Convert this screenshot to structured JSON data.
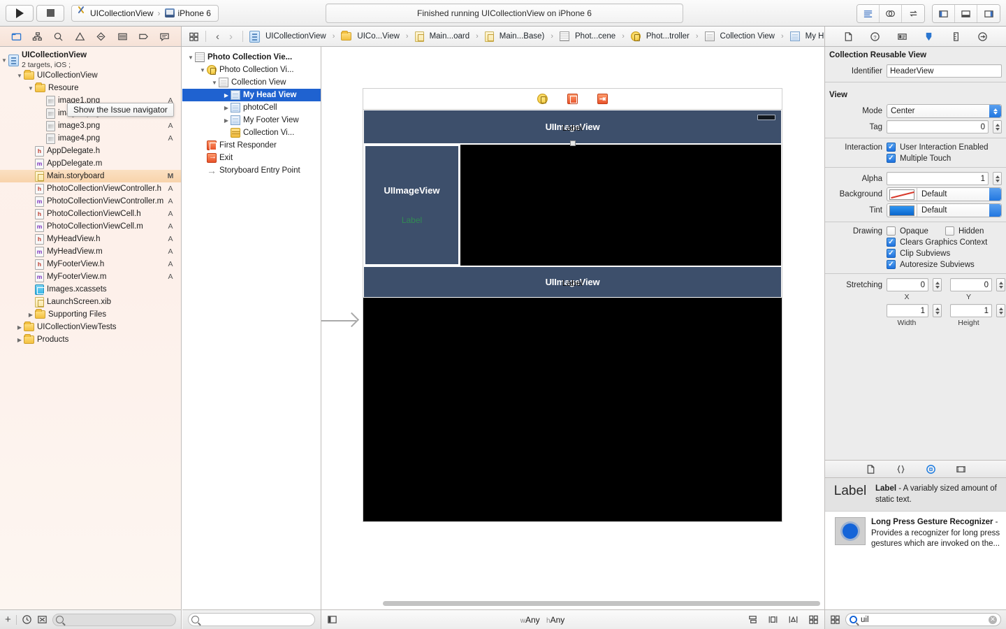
{
  "toolbar": {
    "run_button": "run-button",
    "stop_button": "stop-button",
    "scheme_name": "UICollectionView",
    "destination_name": "iPhone 6",
    "activity_status": "Finished running UICollectionView on iPhone 6",
    "editor_modes": [
      "standard-editor",
      "assistant-editor",
      "version-editor"
    ],
    "view_toggles": [
      "navigator-toggle",
      "debug-area-toggle",
      "utilities-toggle"
    ]
  },
  "navigator": {
    "tab_icons": [
      "project-navigator",
      "symbol-navigator",
      "find-navigator",
      "issue-navigator",
      "test-navigator",
      "debug-navigator",
      "breakpoint-navigator",
      "report-navigator"
    ],
    "tooltip": "Show the Issue navigator",
    "project": {
      "name": "UICollectionView",
      "subtitle": "2 targets, iOS ;"
    },
    "items": [
      {
        "label": "UICollectionView",
        "type": "folder",
        "indent": 1,
        "disclosure": "open",
        "status": ""
      },
      {
        "label": "Resoure",
        "type": "folder",
        "indent": 2,
        "disclosure": "open",
        "status": ""
      },
      {
        "label": "image1.png",
        "type": "png",
        "indent": 3,
        "disclosure": "",
        "status": "A"
      },
      {
        "label": "image2.png",
        "type": "png",
        "indent": 3,
        "disclosure": "",
        "status": "A"
      },
      {
        "label": "image3.png",
        "type": "png",
        "indent": 3,
        "disclosure": "",
        "status": "A"
      },
      {
        "label": "image4.png",
        "type": "png",
        "indent": 3,
        "disclosure": "",
        "status": "A"
      },
      {
        "label": "AppDelegate.h",
        "type": "h",
        "indent": 2,
        "disclosure": "",
        "status": ""
      },
      {
        "label": "AppDelegate.m",
        "type": "m",
        "indent": 2,
        "disclosure": "",
        "status": ""
      },
      {
        "label": "Main.storyboard",
        "type": "storyboard",
        "indent": 2,
        "disclosure": "",
        "status": "M",
        "selected": true
      },
      {
        "label": "PhotoCollectionViewController.h",
        "type": "h",
        "indent": 2,
        "disclosure": "",
        "status": "A"
      },
      {
        "label": "PhotoCollectionViewController.m",
        "type": "m",
        "indent": 2,
        "disclosure": "",
        "status": "A"
      },
      {
        "label": "PhotoCollectionViewCell.h",
        "type": "h",
        "indent": 2,
        "disclosure": "",
        "status": "A"
      },
      {
        "label": "PhotoCollectionViewCell.m",
        "type": "m",
        "indent": 2,
        "disclosure": "",
        "status": "A"
      },
      {
        "label": "MyHeadView.h",
        "type": "h",
        "indent": 2,
        "disclosure": "",
        "status": "A"
      },
      {
        "label": "MyHeadView.m",
        "type": "m",
        "indent": 2,
        "disclosure": "",
        "status": "A"
      },
      {
        "label": "MyFooterView.h",
        "type": "h",
        "indent": 2,
        "disclosure": "",
        "status": "A"
      },
      {
        "label": "MyFooterView.m",
        "type": "m",
        "indent": 2,
        "disclosure": "",
        "status": "A"
      },
      {
        "label": "Images.xcassets",
        "type": "xcassets",
        "indent": 2,
        "disclosure": "",
        "status": ""
      },
      {
        "label": "LaunchScreen.xib",
        "type": "storyboard",
        "indent": 2,
        "disclosure": "",
        "status": ""
      },
      {
        "label": "Supporting Files",
        "type": "folder",
        "indent": 2,
        "disclosure": "closed",
        "status": ""
      },
      {
        "label": "UICollectionViewTests",
        "type": "folder",
        "indent": 1,
        "disclosure": "closed",
        "status": ""
      },
      {
        "label": "Products",
        "type": "folder",
        "indent": 1,
        "disclosure": "closed",
        "status": ""
      }
    ],
    "bottom": {
      "add_button": "+",
      "filter_placeholder": ""
    }
  },
  "jumpbar": {
    "back": "‹",
    "forward": "›",
    "crumbs": [
      {
        "label": "UICollectionView",
        "icon": "project-icon"
      },
      {
        "label": "UICo...View",
        "icon": "folder-icon"
      },
      {
        "label": "Main...oard",
        "icon": "storyboard-icon"
      },
      {
        "label": "Main...Base)",
        "icon": "storyboard-icon"
      },
      {
        "label": "Phot...cene",
        "icon": "scene-icon"
      },
      {
        "label": "Phot...troller",
        "icon": "viewcontroller-icon"
      },
      {
        "label": "Collection View",
        "icon": "collectionview-icon"
      },
      {
        "label": "My Head View",
        "icon": "reusableview-icon"
      }
    ]
  },
  "outline": {
    "items": [
      {
        "label": "Photo Collection Vie...",
        "indent": 0,
        "disclosure": "open",
        "icon": "scene-icon",
        "bold": true
      },
      {
        "label": "Photo Collection Vi...",
        "indent": 1,
        "disclosure": "open",
        "icon": "viewcontroller-icon"
      },
      {
        "label": "Collection View",
        "indent": 2,
        "disclosure": "open",
        "icon": "collectionview-icon"
      },
      {
        "label": "My Head View",
        "indent": 3,
        "disclosure": "closed",
        "icon": "reusableview-icon",
        "selected": true
      },
      {
        "label": "photoCell",
        "indent": 3,
        "disclosure": "closed",
        "icon": "cell-icon"
      },
      {
        "label": "My Footer View",
        "indent": 3,
        "disclosure": "closed",
        "icon": "reusableview-icon"
      },
      {
        "label": "Collection Vi...",
        "indent": 3,
        "disclosure": "",
        "icon": "flowlayout-icon"
      },
      {
        "label": "First Responder",
        "indent": 1,
        "disclosure": "",
        "icon": "first-responder-icon"
      },
      {
        "label": "Exit",
        "indent": 1,
        "disclosure": "",
        "icon": "exit-icon"
      },
      {
        "label": "Storyboard Entry Point",
        "indent": 1,
        "disclosure": "",
        "icon": "entry-point-icon"
      }
    ]
  },
  "canvas": {
    "dock_icons": [
      "view-controller-icon",
      "first-responder-icon",
      "exit-icon"
    ],
    "header_view": {
      "image_label": "UIImageView",
      "text_label": "Label"
    },
    "photo_cell": {
      "image_label": "UIImageView",
      "text_label": "Label"
    },
    "footer_view": {
      "image_label": "UIImageView",
      "text_label": "Label"
    },
    "size_class": {
      "prefix_w": "w",
      "width": "Any",
      "prefix_h": "h",
      "height": "Any"
    },
    "bottom_icons": [
      "auto-layout-stack",
      "align-icon",
      "pin-icon",
      "resolve-issues-icon"
    ]
  },
  "inspector": {
    "tabs": [
      "file-inspector",
      "quick-help-inspector",
      "identity-inspector",
      "attributes-inspector",
      "size-inspector",
      "connections-inspector"
    ],
    "selected_tab_index": 3,
    "reusable_view": {
      "title": "Collection Reusable View",
      "identifier_label": "Identifier",
      "identifier_value": "HeaderView"
    },
    "view": {
      "title": "View",
      "mode_label": "Mode",
      "mode_value": "Center",
      "tag_label": "Tag",
      "tag_value": "0",
      "interaction_label": "Interaction",
      "user_interaction_enabled": {
        "label": "User Interaction Enabled",
        "checked": true
      },
      "multiple_touch": {
        "label": "Multiple Touch",
        "checked": true
      },
      "alpha_label": "Alpha",
      "alpha_value": "1",
      "background_label": "Background",
      "background_value": "Default",
      "tint_label": "Tint",
      "tint_value": "Default",
      "drawing_label": "Drawing",
      "opaque": {
        "label": "Opaque",
        "checked": false
      },
      "hidden": {
        "label": "Hidden",
        "checked": false
      },
      "clears_graphics_context": {
        "label": "Clears Graphics Context",
        "checked": true
      },
      "clip_subviews": {
        "label": "Clip Subviews",
        "checked": true
      },
      "autoresize_subviews": {
        "label": "Autoresize Subviews",
        "checked": true
      },
      "stretching_label": "Stretching",
      "stretch_x": "0",
      "stretch_y": "0",
      "stretch_width": "1",
      "stretch_height": "1",
      "caption_x": "X",
      "caption_y": "Y",
      "caption_width": "Width",
      "caption_height": "Height"
    }
  },
  "library": {
    "tabs": [
      "file-template-library",
      "code-snippet-library",
      "object-library",
      "media-library"
    ],
    "selected_tab_index": 2,
    "items": [
      {
        "thumb": "Label",
        "name": "Label",
        "description": " - A variably sized amount of static text.",
        "selected": true
      },
      {
        "thumb": "gesture-recognizer-icon",
        "name": "Long Press Gesture Recognizer",
        "description": " - Provides a recognizer for long press gestures which are invoked on the...",
        "selected": false
      }
    ],
    "search_value": "uil"
  },
  "colors": {
    "accent": "#1f62d0",
    "navigator_bg": "#fdf2ec",
    "selection_orange": "#f8d3ab",
    "storyboard_blue": "#3d4f6b",
    "checkbox_blue": "#1f72de"
  }
}
